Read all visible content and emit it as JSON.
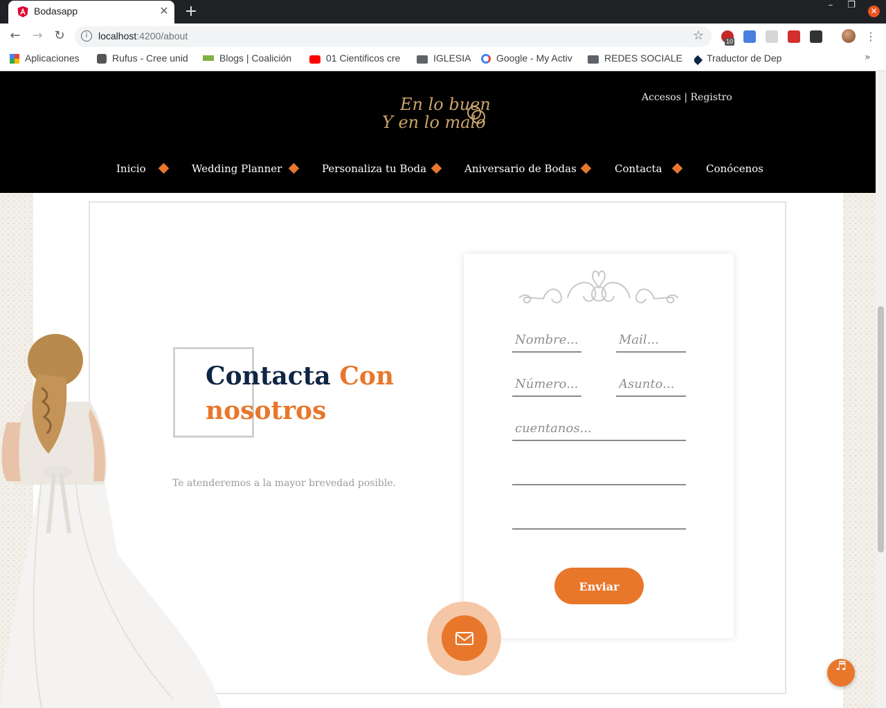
{
  "browser": {
    "tab_title": "Bodasapp",
    "url_host": "localhost",
    "url_path": ":4200/about",
    "extension_badge": "10",
    "bookmarks": [
      "Aplicaciones",
      "Rufus - Cree unid",
      "Blogs | Coalición",
      "01 Cientificos cre",
      "IGLESIA",
      "Google - My Activ",
      "REDES SOCIALES",
      "Traductor de Dep"
    ]
  },
  "site": {
    "logo_line1": "En lo bueno",
    "logo_line2": "Y en lo malo",
    "auth_links": "Accesos | Registro",
    "nav": [
      "Inicio",
      "Wedding Planner",
      "Personaliza tu Boda",
      "Aniversario de Bodas",
      "Contacta",
      "Conócenos"
    ]
  },
  "contact": {
    "title_part1": "Contacta",
    "title_part2": "Con",
    "title_part3": "nosotros",
    "subtitle": "Te atenderemos a la mayor brevedad posible.",
    "form": {
      "name_placeholder": "Nombre...",
      "mail_placeholder": "Mail...",
      "number_placeholder": "Número...",
      "subject_placeholder": "Asunto...",
      "message_placeholder": "cuentanos...",
      "submit_label": "Enviar"
    }
  },
  "colors": {
    "accent": "#e8772c",
    "navy": "#0f2545",
    "header_bg": "#000000"
  }
}
